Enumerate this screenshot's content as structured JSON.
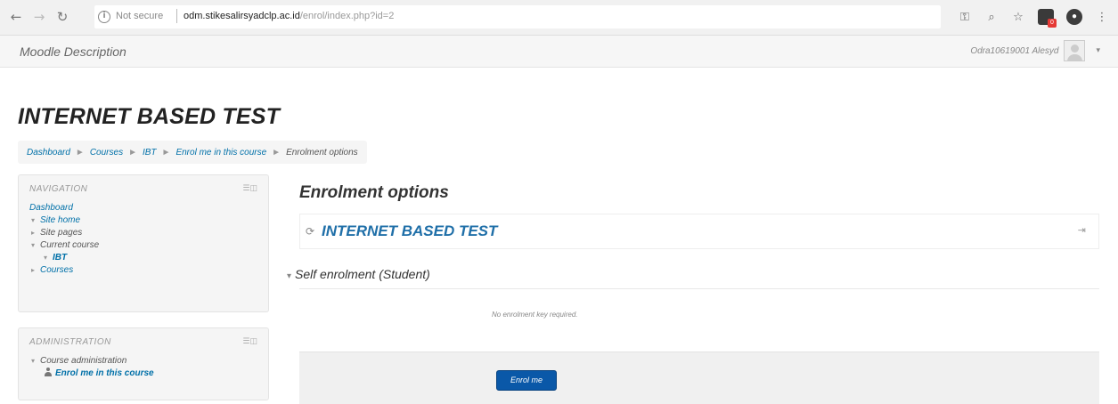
{
  "browser": {
    "not_secure": "Not secure",
    "url_host": "odm.stikesalirsyadclp.ac.id",
    "url_path": "/enrol/index.php?id=2",
    "back_icon": "arrow-left",
    "forward_icon": "arrow-right",
    "reload_icon": "reload",
    "info_icon": "info-circle",
    "ext_badge": "0",
    "profile_initial": "●"
  },
  "navbar": {
    "brand": "Moodle Description",
    "username": "Odra10619001 Alesyd"
  },
  "page": {
    "title": "INTERNET BASED TEST"
  },
  "breadcrumb": {
    "items": [
      "Dashboard",
      "Courses",
      "IBT",
      "Enrol me in this course"
    ],
    "current": "Enrolment options"
  },
  "navigation_block": {
    "title": "NAVIGATION",
    "dashboard": "Dashboard",
    "site_home": "Site home",
    "site_pages": "Site pages",
    "current_course": "Current course",
    "course_short": "IBT",
    "courses": "Courses"
  },
  "admin_block": {
    "title": "ADMINISTRATION",
    "course_admin": "Course administration",
    "enrol_link": "Enrol me in this course"
  },
  "main": {
    "heading": "Enrolment options",
    "course_name": "INTERNET BASED TEST",
    "section": "Self enrolment (Student)",
    "no_key": "No enrolment key required.",
    "enrol_button": "Enrol me"
  }
}
